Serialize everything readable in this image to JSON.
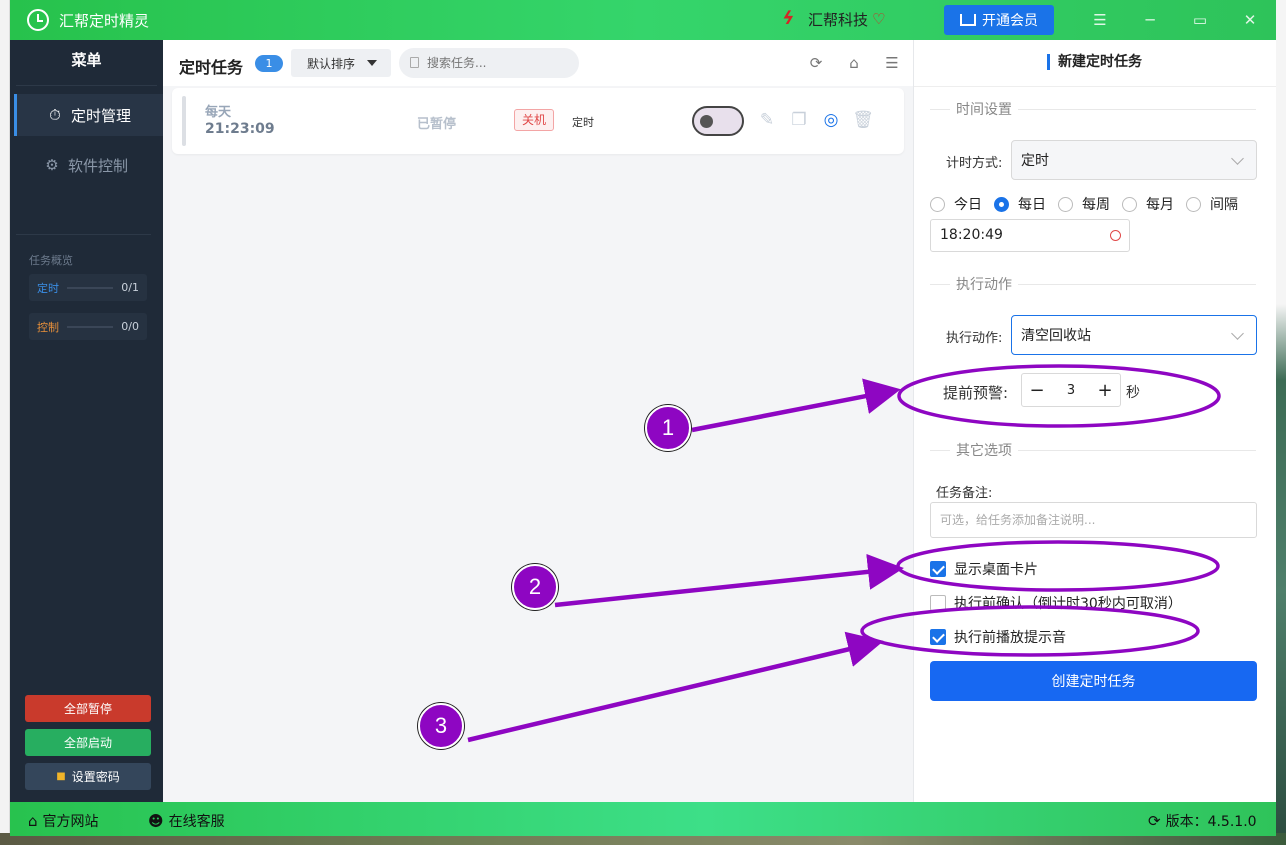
{
  "app": {
    "title": "汇帮定时精灵",
    "brand": "汇帮科技",
    "vip_label": "开通会员"
  },
  "sidebar": {
    "menu_title": "菜单",
    "items": [
      {
        "label": "定时管理",
        "icon": "clock-icon",
        "active": true
      },
      {
        "label": "软件控制",
        "icon": "gear-icon",
        "active": false
      }
    ],
    "overview_title": "任务概览",
    "overview": [
      {
        "label": "定时",
        "count": "0/1",
        "color": "#3a8ee6"
      },
      {
        "label": "控制",
        "count": "0/0",
        "color": "#e8903a"
      }
    ],
    "buttons": {
      "pause_all": "全部暂停",
      "start_all": "全部启动",
      "set_password": "设置密码"
    }
  },
  "tasks": {
    "title": "定时任务",
    "count": "1",
    "sort_label": "默认排序",
    "search_placeholder": "搜索任务...",
    "items": [
      {
        "frequency": "每天",
        "time": "21:23:09",
        "status": "已暂停",
        "action_tag": "关机",
        "type": "定时"
      }
    ]
  },
  "form": {
    "title": "新建定时任务",
    "section_time": "时间设置",
    "timing_mode_label": "计时方式:",
    "timing_mode_value": "定时",
    "repeat_options": [
      {
        "label": "今日",
        "selected": false
      },
      {
        "label": "每日",
        "selected": true
      },
      {
        "label": "每周",
        "selected": false
      },
      {
        "label": "每月",
        "selected": false
      },
      {
        "label": "间隔",
        "selected": false
      }
    ],
    "time_value": "18:20:49",
    "section_action": "执行动作",
    "action_label": "执行动作:",
    "action_value": "清空回收站",
    "warning_label": "提前预警:",
    "warning_value": "3",
    "warning_unit": "秒",
    "section_other": "其它选项",
    "note_label": "任务备注:",
    "note_placeholder": "可选，给任务添加备注说明...",
    "options": [
      {
        "label": "显示桌面卡片",
        "checked": true
      },
      {
        "label": "执行前确认（倒计时30秒内可取消）",
        "checked": false
      },
      {
        "label": "执行前播放提示音",
        "checked": true
      }
    ],
    "submit_label": "创建定时任务"
  },
  "footer": {
    "website": "官方网站",
    "support": "在线客服",
    "version": "版本：4.5.1.0"
  },
  "annotations": [
    "1",
    "2",
    "3"
  ],
  "colors": {
    "accent": "#1a73e8",
    "annotation": "#8e06c2",
    "titlebar": "#2ec35a"
  }
}
